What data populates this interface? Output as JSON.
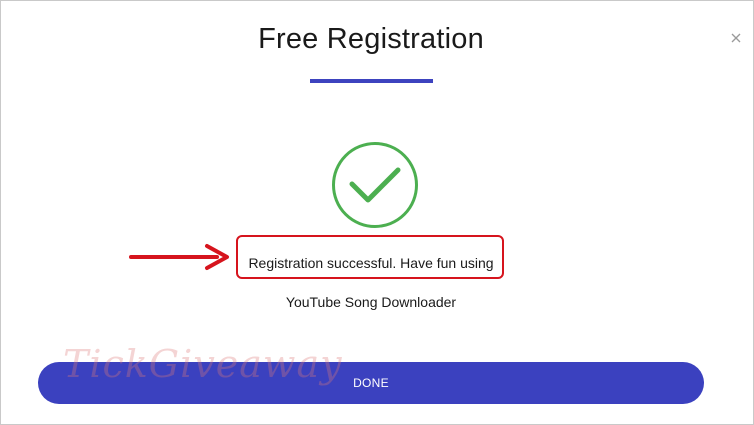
{
  "dialog": {
    "title": "Free Registration",
    "success_message": "Registration successful. Have fun using",
    "product_name": "YouTube Song Downloader",
    "done_label": "DONE",
    "watermark": "TickGiveaway"
  },
  "icons": {
    "status": "check-circle-icon",
    "annotation": "arrow-right-icon",
    "close": "close-icon"
  },
  "colors": {
    "accent": "#3b41bf",
    "success": "#4caf50",
    "annotation_red": "#d6141d"
  }
}
